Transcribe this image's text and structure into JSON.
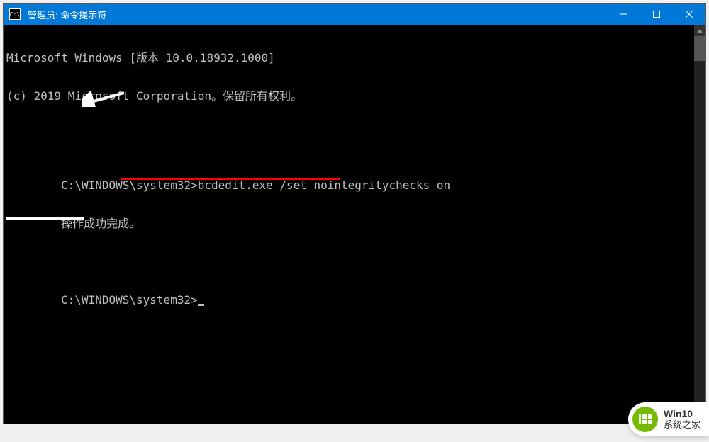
{
  "titlebar": {
    "icon_text": "C:\\",
    "title": "管理员: 命令提示符"
  },
  "console": {
    "line1": "Microsoft Windows [版本 10.0.18932.1000]",
    "line2": "(c) 2019 Microsoft Corporation。保留所有权利。",
    "blank1": "",
    "prompt1": "C:\\WINDOWS\\system32>",
    "command1": "bcdedit.exe /set nointegritychecks on",
    "result1": "操作成功完成。",
    "blank2": "",
    "prompt2": "C:\\WINDOWS\\system32>"
  },
  "watermark": {
    "logo_text": "I0",
    "line1": "Win10",
    "line2": "系统之家"
  }
}
